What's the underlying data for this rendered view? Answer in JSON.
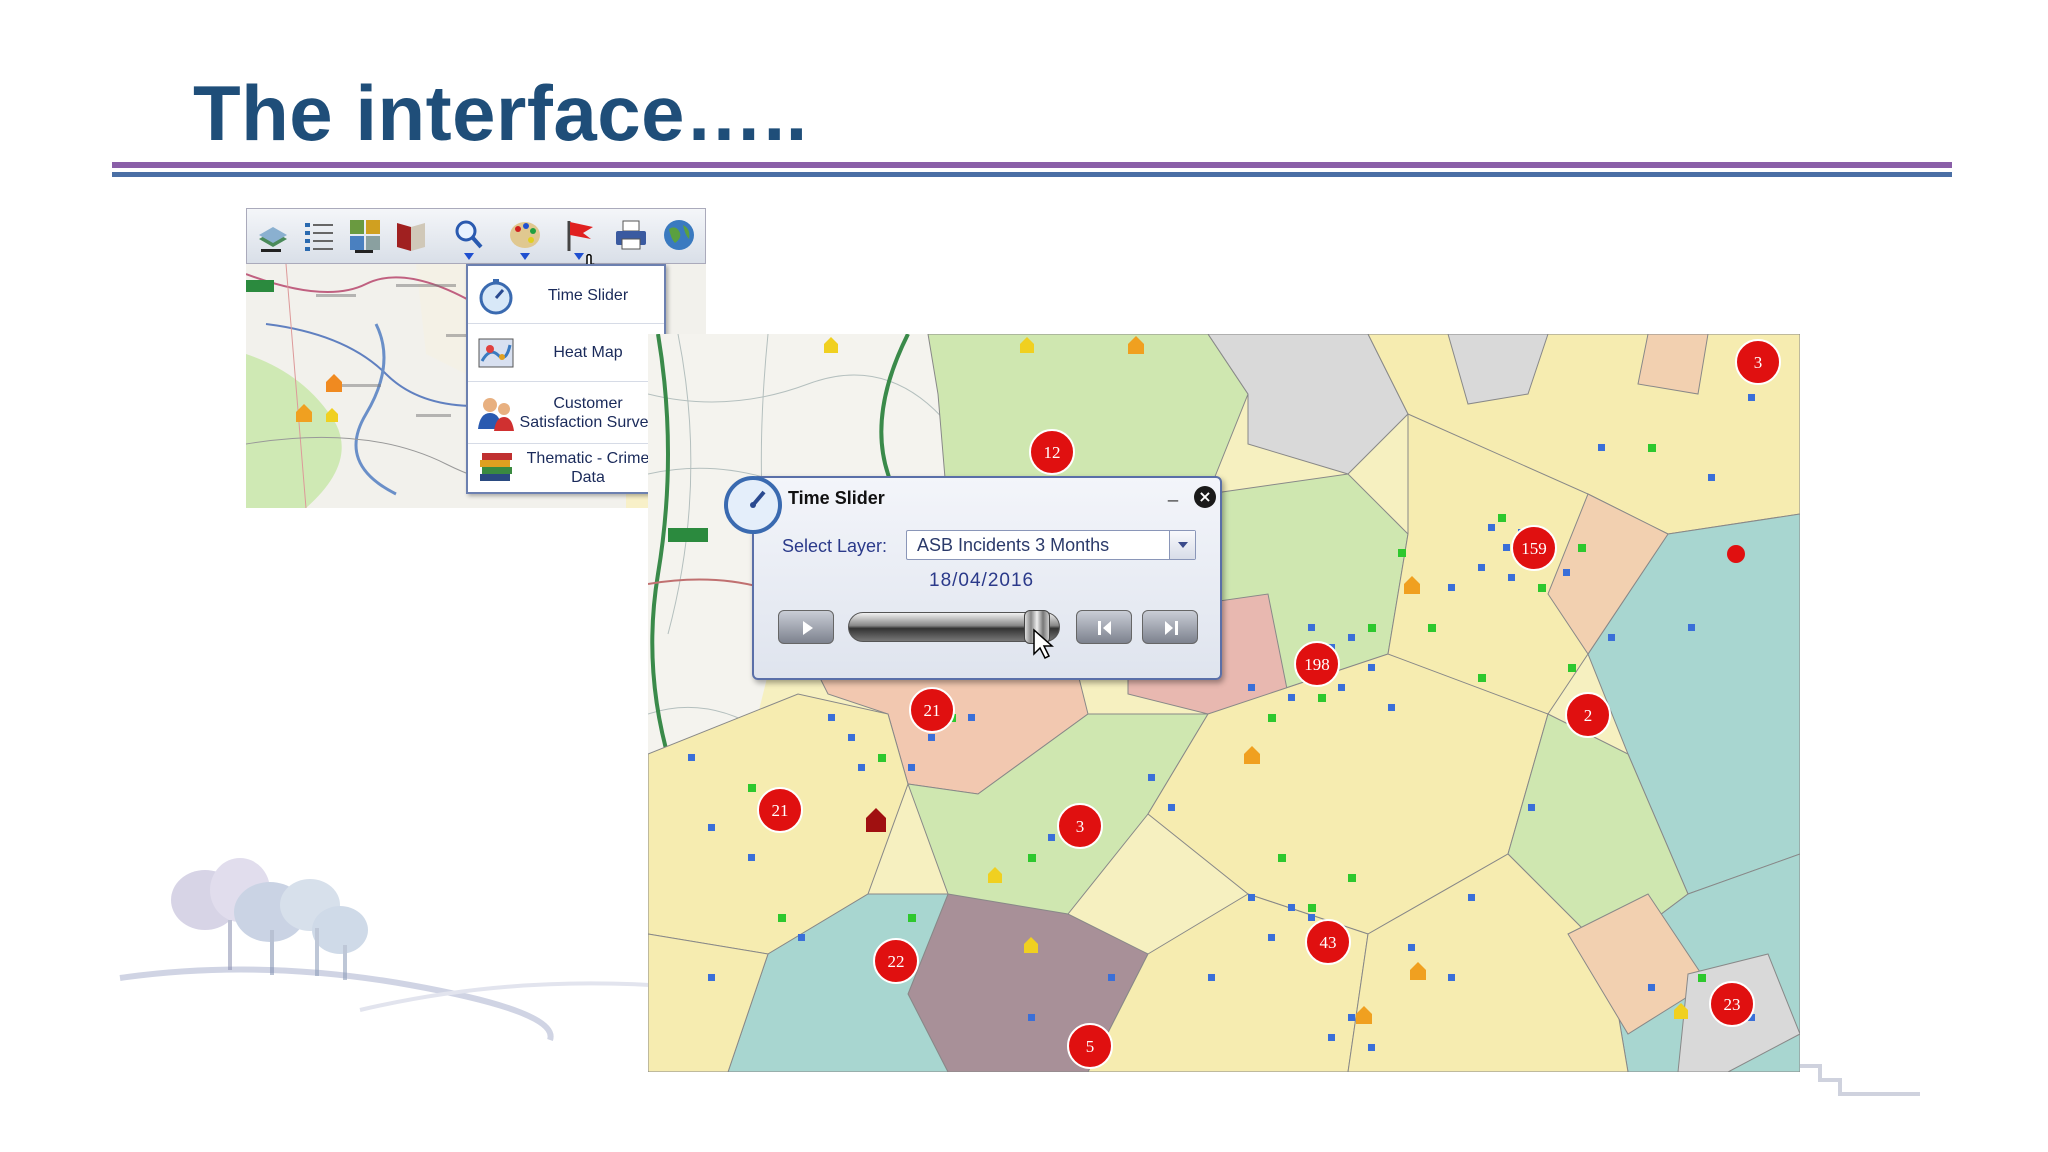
{
  "slide": {
    "title": "The interface….."
  },
  "toolbar": {
    "icons": [
      "layers-icon",
      "legend-list-icon",
      "grid-tiles-icon",
      "book-icon",
      "search-icon",
      "palette-icon",
      "flag-icon",
      "printer-icon",
      "globe-icon"
    ]
  },
  "analysis_menu": {
    "items": [
      {
        "label": "Time Slider",
        "icon": "stopwatch-icon"
      },
      {
        "label": "Heat Map",
        "icon": "heat-map-icon"
      },
      {
        "label": "Customer Satisfaction Survey",
        "icon": "people-icon"
      },
      {
        "label": "Thematic - Crime Data",
        "icon": "stacked-layers-icon"
      }
    ]
  },
  "time_slider": {
    "title": "Time Slider",
    "minimize": "_",
    "close": "×",
    "select_label": "Select Layer:",
    "selected_layer": "ASB Incidents 3 Months",
    "date": "18/04/2016",
    "progress": 0.95
  },
  "clusters": [
    "12",
    "3",
    "159",
    "198",
    "2",
    "21",
    "21",
    "3",
    "43",
    "22",
    "5",
    "23"
  ],
  "colors": {
    "title": "#1f4e79",
    "rule_purple": "#8a5fa8",
    "rule_blue": "#4a6fa5",
    "cluster_red": "#e01010",
    "incident_blue": "#3a6fd8",
    "incident_green": "#2ec82e",
    "house_orange": "#f0a020"
  }
}
